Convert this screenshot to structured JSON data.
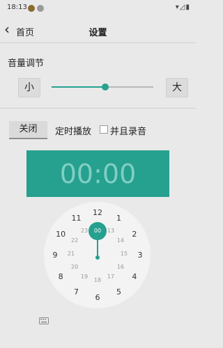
{
  "status_bar": {
    "time": "18:13",
    "right_icons": "▾◿▮"
  },
  "header": {
    "back_label": "首页",
    "title": "设置"
  },
  "volume": {
    "title": "音量调节",
    "min_label": "小",
    "max_label": "大",
    "level": 0.53
  },
  "timer": {
    "close_label": "关闭",
    "timer_label": "定时播放",
    "record_label": "并且录音",
    "record_checked": false
  },
  "display": {
    "time_text": "00:00"
  },
  "clock": {
    "outer": [
      "12",
      "1",
      "2",
      "3",
      "4",
      "5",
      "6",
      "7",
      "8",
      "9",
      "10",
      "11"
    ],
    "inner": [
      "00",
      "13",
      "14",
      "15",
      "16",
      "17",
      "18",
      "19",
      "20",
      "21",
      "22",
      "23"
    ],
    "selected": "00"
  },
  "colors": {
    "accent": "#26a08f",
    "background": "#e9e9e9"
  },
  "icons": [
    "back-chevron-icon",
    "keyboard-icon"
  ]
}
